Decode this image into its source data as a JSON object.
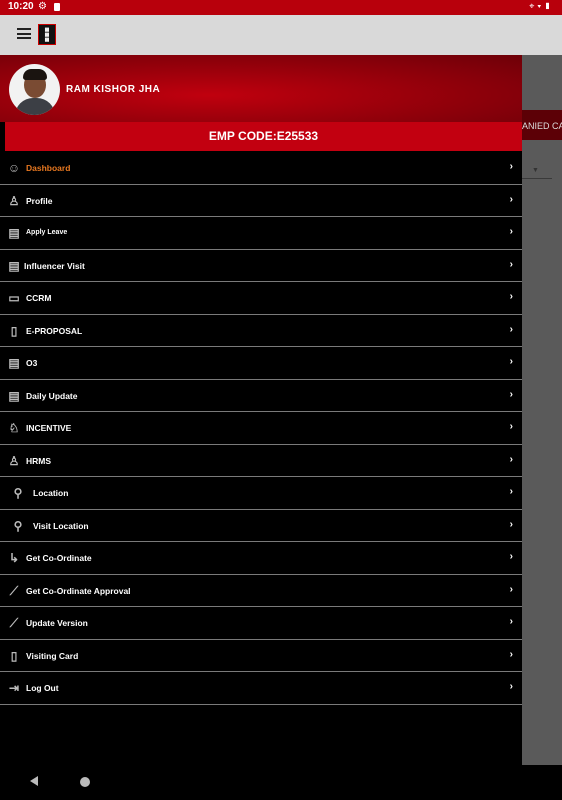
{
  "status": {
    "time": "10:20"
  },
  "drawer": {
    "user_name": "RAM  KISHOR  JHA",
    "emp_code": "EMP CODE:E25533",
    "items": [
      {
        "label": "Dashboard",
        "icon": "dashboard-icon"
      },
      {
        "label": "Profile",
        "icon": "profile-icon"
      },
      {
        "label": "Apply Leave",
        "icon": "leave-icon"
      },
      {
        "label": "Influencer Visit",
        "icon": "influencer-icon"
      },
      {
        "label": "CCRM",
        "icon": "ccrm-icon"
      },
      {
        "label": "E-PROPOSAL",
        "icon": "proposal-icon"
      },
      {
        "label": "O3",
        "icon": "o3-icon"
      },
      {
        "label": "Daily Update",
        "icon": "daily-update-icon"
      },
      {
        "label": "INCENTIVE",
        "icon": "incentive-icon"
      },
      {
        "label": "HRMS",
        "icon": "hrms-icon"
      },
      {
        "label": "Location",
        "icon": "location-pin-icon"
      },
      {
        "label": "Visit Location",
        "icon": "location-pin-icon"
      },
      {
        "label": "Get Co-Ordinate",
        "icon": "coordinate-icon"
      },
      {
        "label": "Get Co-Ordinate Approval",
        "icon": "chart-line-icon"
      },
      {
        "label": "Update Version",
        "icon": "chart-line-icon"
      },
      {
        "label": "Visiting Card",
        "icon": "visiting-card-icon"
      },
      {
        "label": "Log Out",
        "icon": "logout-icon"
      }
    ]
  },
  "background": {
    "tab_fragment": "ANIED CAL"
  },
  "colors": {
    "accent": "#e87820",
    "header_red": "#c20010",
    "status_bar": "#b8000c"
  }
}
